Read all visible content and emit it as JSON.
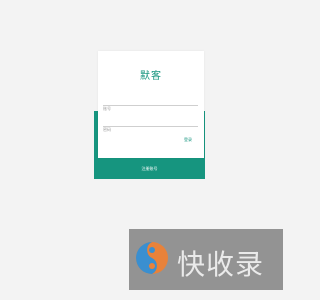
{
  "card": {
    "title": "默客",
    "username_placeholder": "账号",
    "password_placeholder": "密码",
    "login_label": "登录",
    "register_label": "注册账号"
  },
  "watermark": {
    "text": "快收录"
  },
  "colors": {
    "accent": "#16957f",
    "background": "#f3f3f3",
    "card": "#ffffff"
  }
}
